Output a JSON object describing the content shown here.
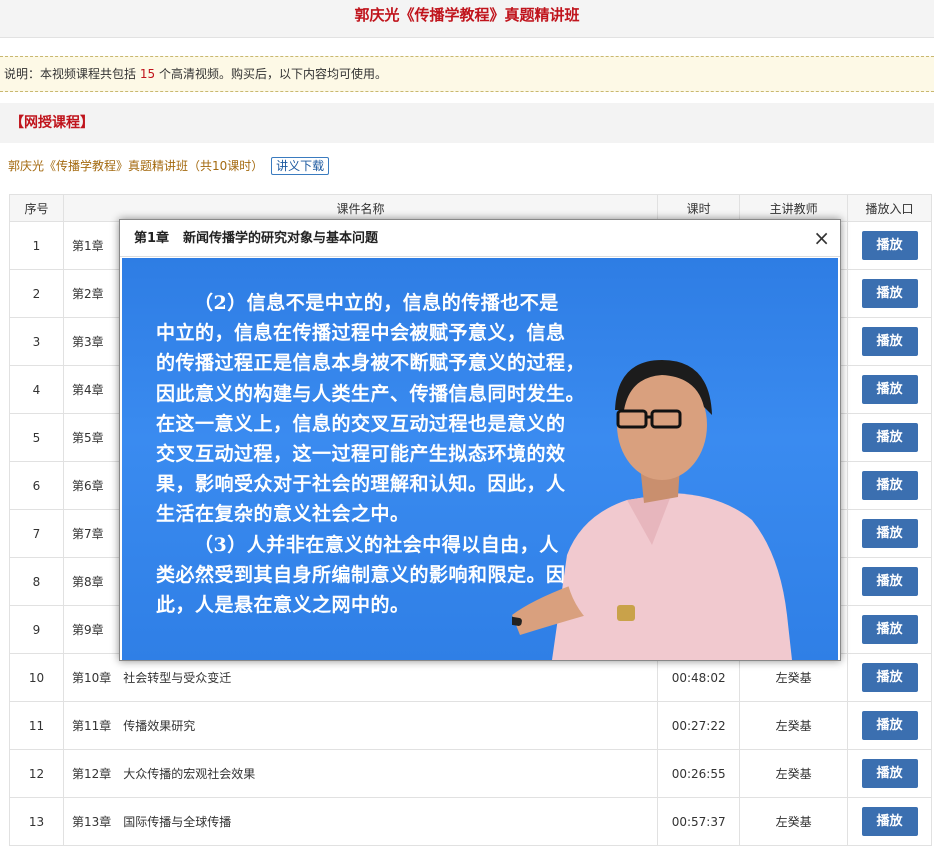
{
  "header": {
    "title": "郭庆光《传播学教程》真题精讲班"
  },
  "notice": {
    "prefix": "说明：本视频课程共包括",
    "count": "15",
    "suffix": "个高清视频。购买后，以下内容均可使用。"
  },
  "section": {
    "title": "【网授课程】"
  },
  "course": {
    "name": "郭庆光《传播学教程》真题精讲班（共10课时）",
    "download_label": "讲义下载"
  },
  "table": {
    "headers": [
      "序号",
      "课件名称",
      "课时",
      "主讲教师",
      "播放入口"
    ],
    "play_label": "播放",
    "rows": [
      {
        "no": "1",
        "chapter": "第1章",
        "title": "",
        "duration": "",
        "teacher": ""
      },
      {
        "no": "2",
        "chapter": "第2章",
        "title": "",
        "duration": "",
        "teacher": ""
      },
      {
        "no": "3",
        "chapter": "第3章",
        "title": "",
        "duration": "",
        "teacher": ""
      },
      {
        "no": "4",
        "chapter": "第4章",
        "title": "",
        "duration": "",
        "teacher": ""
      },
      {
        "no": "5",
        "chapter": "第5章",
        "title": "",
        "duration": "",
        "teacher": ""
      },
      {
        "no": "6",
        "chapter": "第6章",
        "title": "",
        "duration": "",
        "teacher": ""
      },
      {
        "no": "7",
        "chapter": "第7章",
        "title": "",
        "duration": "",
        "teacher": ""
      },
      {
        "no": "8",
        "chapter": "第8章",
        "title": "",
        "duration": "",
        "teacher": ""
      },
      {
        "no": "9",
        "chapter": "第9章",
        "title": "",
        "duration": "",
        "teacher": ""
      },
      {
        "no": "10",
        "chapter": "第10章",
        "title": "社会转型与受众变迁",
        "duration": "00:48:02",
        "teacher": "左癸基"
      },
      {
        "no": "11",
        "chapter": "第11章",
        "title": "传播效果研究",
        "duration": "00:27:22",
        "teacher": "左癸基"
      },
      {
        "no": "12",
        "chapter": "第12章",
        "title": "大众传播的宏观社会效果",
        "duration": "00:26:55",
        "teacher": "左癸基"
      },
      {
        "no": "13",
        "chapter": "第13章",
        "title": "国际传播与全球传播",
        "duration": "00:57:37",
        "teacher": "左癸基"
      }
    ]
  },
  "modal": {
    "chapter": "第1章",
    "title": "新闻传播学的研究对象与基本问题",
    "close_glyph": "×",
    "slide_lines": [
      "（2）信息不是中立的，信息的传播也不是",
      "中立的，信息在传播过程中会被赋予意义，信息",
      "的传播过程正是信息本身被不断赋予意义的过程，",
      "因此意义的构建与人类生产、传播信息同时发生。",
      "在这一意义上，信息的交叉互动过程也是意义的",
      "交叉互动过程，这一过程可能产生拟态环境的效",
      "果，影响受众对于社会的理解和认知。因此，人",
      "生活在复杂的意义社会之中。",
      "（3）人并非在意义的社会中得以自由，人",
      "类必然受到其自身所编制意义的影响和限定。因",
      "此，人是悬在意义之网中的。"
    ],
    "colors": {
      "video_bg": "#3187ec",
      "shirt": "#f1c9cf",
      "skin": "#d9a07e"
    }
  }
}
